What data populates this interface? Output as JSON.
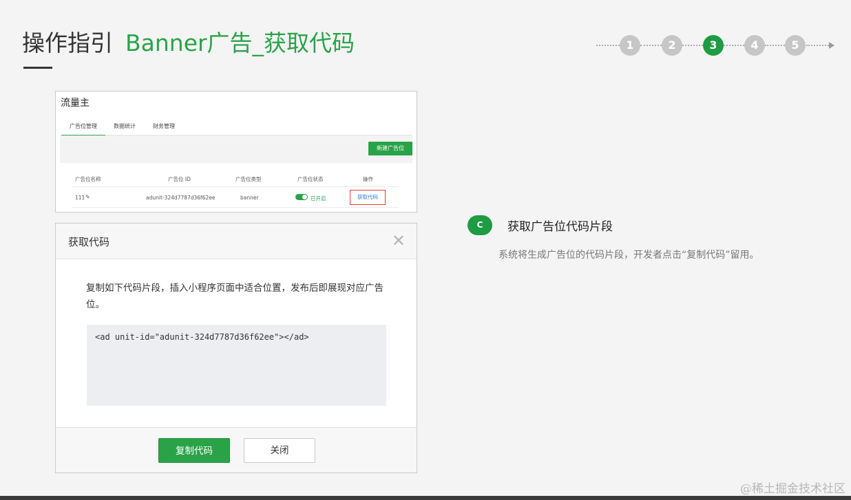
{
  "header": {
    "title_main": "操作指引",
    "title_sub": "Banner广告_获取代码"
  },
  "stepper": {
    "steps": [
      "1",
      "2",
      "3",
      "4",
      "5"
    ],
    "active": "3",
    "colors": {
      "active": "#1f9b43",
      "inactive": "#c6c6c6"
    }
  },
  "console": {
    "app_name": "流量主",
    "tabs": [
      "广告位管理",
      "数据统计",
      "财务管理"
    ],
    "active_tab": "广告位管理",
    "new_button": "新建广告位",
    "columns": [
      "广告位名称",
      "广告位 ID",
      "广告位类型",
      "广告位状态",
      "操作"
    ],
    "rows": [
      {
        "name": "111",
        "edit_icon": "pencil-icon",
        "id": "adunit-324d7787d36f62ee",
        "type": "banner",
        "status": "已开启",
        "action": "获取代码"
      }
    ]
  },
  "dialog": {
    "title": "获取代码",
    "close_icon": "close-icon",
    "description": "复制如下代码片段，插入小程序页面中适合位置，发布后即展现对应广告位。",
    "code": "<ad unit-id=\"adunit-324d7787d36f62ee\"></ad>",
    "copy_button": "复制代码",
    "close_button": "关闭"
  },
  "instruction": {
    "badge": "C",
    "heading": "获取广告位代码片段",
    "text": "系统将生成广告位的代码片段，开发者点击“复制代码”留用。"
  },
  "watermark": "@稀土掘金技术社区",
  "colors": {
    "accent": "#2aa348",
    "highlight_border": "#e23b3b",
    "link": "#2a7ee0"
  }
}
